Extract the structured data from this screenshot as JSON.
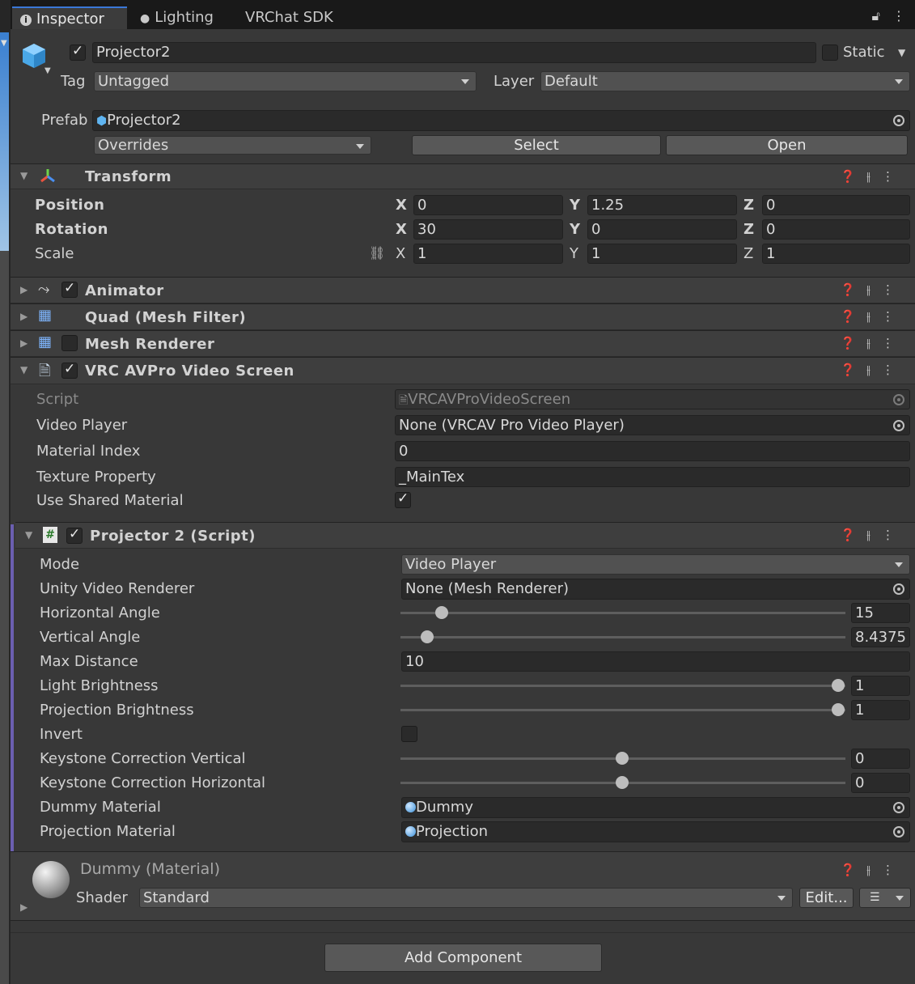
{
  "tabs": [
    {
      "label": "Inspector",
      "icon": "info-icon",
      "active": true
    },
    {
      "label": "Lighting",
      "icon": "lightbulb-icon",
      "active": false
    },
    {
      "label": "VRChat SDK",
      "icon": "",
      "active": false
    }
  ],
  "object": {
    "name": "Projector2",
    "active": true,
    "static_label": "Static",
    "tag_label": "Tag",
    "tag_value": "Untagged",
    "layer_label": "Layer",
    "layer_value": "Default",
    "prefab_label": "Prefab",
    "prefab_value": "Projector2",
    "overrides": "Overrides",
    "select": "Select",
    "open": "Open"
  },
  "transform": {
    "title": "Transform",
    "rows": [
      {
        "label": "Position",
        "x": "0",
        "y": "1.25",
        "z": "0"
      },
      {
        "label": "Rotation",
        "x": "30",
        "y": "0",
        "z": "0"
      },
      {
        "label": "Scale",
        "x": "1",
        "y": "1",
        "z": "1"
      }
    ],
    "axis": {
      "x": "X",
      "y": "Y",
      "z": "Z"
    }
  },
  "components": {
    "animator": "Animator",
    "meshfilter": "Quad (Mesh Filter)",
    "meshrenderer": "Mesh Renderer",
    "avpro": "VRC AVPro Video Screen",
    "projector": "Projector 2 (Script)"
  },
  "avpro": {
    "script_label": "Script",
    "script_value": "VRCAVProVideoScreen",
    "video_player_label": "Video Player",
    "video_player_value": "None (VRCAV Pro Video Player)",
    "material_index_label": "Material Index",
    "material_index_value": "0",
    "texture_property_label": "Texture Property",
    "texture_property_value": "_MainTex",
    "use_shared_label": "Use Shared Material",
    "use_shared_value": true
  },
  "projector": {
    "mode_label": "Mode",
    "mode_value": "Video Player",
    "unity_vr_label": "Unity Video Renderer",
    "unity_vr_value": "None (Mesh Renderer)",
    "h_angle_label": "Horizontal Angle",
    "h_angle_value": "15",
    "v_angle_label": "Vertical Angle",
    "v_angle_value": "8.4375",
    "max_dist_label": "Max Distance",
    "max_dist_value": "10",
    "light_b_label": "Light Brightness",
    "light_b_value": "1",
    "proj_b_label": "Projection Brightness",
    "proj_b_value": "1",
    "invert_label": "Invert",
    "invert_value": false,
    "kv_label": "Keystone Correction Vertical",
    "kv_value": "0",
    "kh_label": "Keystone Correction Horizontal",
    "kh_value": "0",
    "dummy_label": "Dummy Material",
    "dummy_value": "Dummy",
    "projmat_label": "Projection Material",
    "projmat_value": "Projection"
  },
  "material": {
    "title": "Dummy (Material)",
    "shader_label": "Shader",
    "shader_value": "Standard",
    "edit": "Edit..."
  },
  "add_component": "Add Component"
}
